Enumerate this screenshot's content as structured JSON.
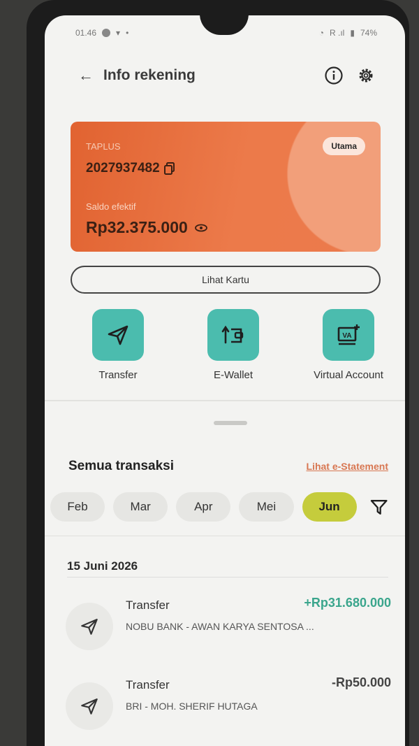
{
  "status": {
    "time": "01.46",
    "battery": "74%"
  },
  "header": {
    "title": "Info rekening"
  },
  "card": {
    "type": "TAPLUS",
    "account_number": "2027937482",
    "badge": "Utama",
    "balance_label": "Saldo efektif",
    "balance": "Rp32.375.000",
    "colors": {
      "primary": "#e16331",
      "accent": "#f29f7a"
    }
  },
  "lihat_kartu": "Lihat Kartu",
  "actions": [
    {
      "label": "Transfer",
      "icon": "send-icon"
    },
    {
      "label": "E-Wallet",
      "icon": "wallet-icon"
    },
    {
      "label": "Virtual Account",
      "icon": "virtual-account-icon"
    }
  ],
  "transactions_section": {
    "title": "Semua transaksi",
    "statement_link": "Lihat e-Statement",
    "months": [
      "Feb",
      "Mar",
      "Apr",
      "Mei",
      "Jun"
    ],
    "selected_month": "Jun"
  },
  "date_group": "15 Juni 2026",
  "transactions": [
    {
      "type": "Transfer",
      "description": "NOBU BANK - AWAN KARYA SENTOSA ...",
      "amount": "+Rp31.680.000",
      "color": "#3aa58c"
    },
    {
      "type": "Transfer",
      "description": "BRI - MOH. SHERIF HUTAGA",
      "amount": "-Rp50.000",
      "color": "#444444"
    }
  ]
}
